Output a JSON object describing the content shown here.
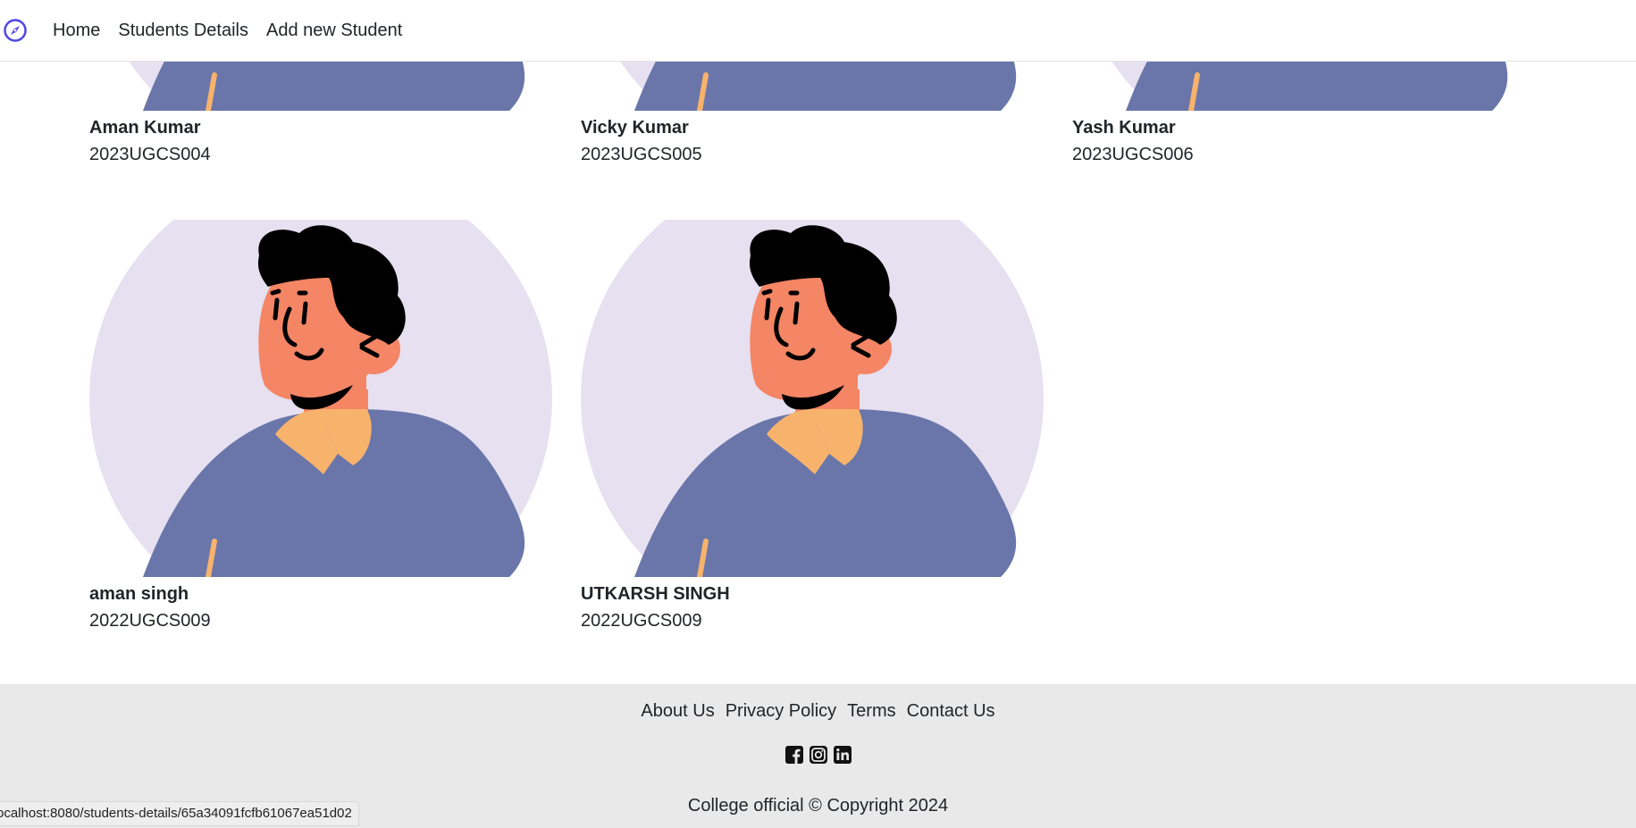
{
  "nav": {
    "brand_icon": "compass-icon",
    "links": [
      "Home",
      "Students Details",
      "Add new Student"
    ]
  },
  "students": [
    {
      "name": "Aman Kumar",
      "id": "2023UGCS004"
    },
    {
      "name": "Vicky Kumar",
      "id": "2023UGCS005"
    },
    {
      "name": "Yash Kumar",
      "id": "2023UGCS006"
    },
    {
      "name": "aman singh",
      "id": "2022UGCS009"
    },
    {
      "name": "UTKARSH SINGH",
      "id": "2022UGCS009"
    }
  ],
  "footer": {
    "links": [
      "About Us",
      "Privacy Policy",
      "Terms",
      "Contact Us"
    ],
    "socials": [
      "facebook-icon",
      "instagram-icon",
      "linkedin-icon"
    ],
    "copyright": "College official © Copyright 2024"
  },
  "status_url": "ocalhost:8080/students-details/65a34091fcfb61067ea51d02",
  "colors": {
    "brand": "#4f46e5",
    "avatar_bg": "#e6e0f0",
    "shirt": "#6a76a9",
    "skin": "#f48565",
    "collar": "#f7b36c",
    "footer_bg": "#e9e9e9"
  }
}
